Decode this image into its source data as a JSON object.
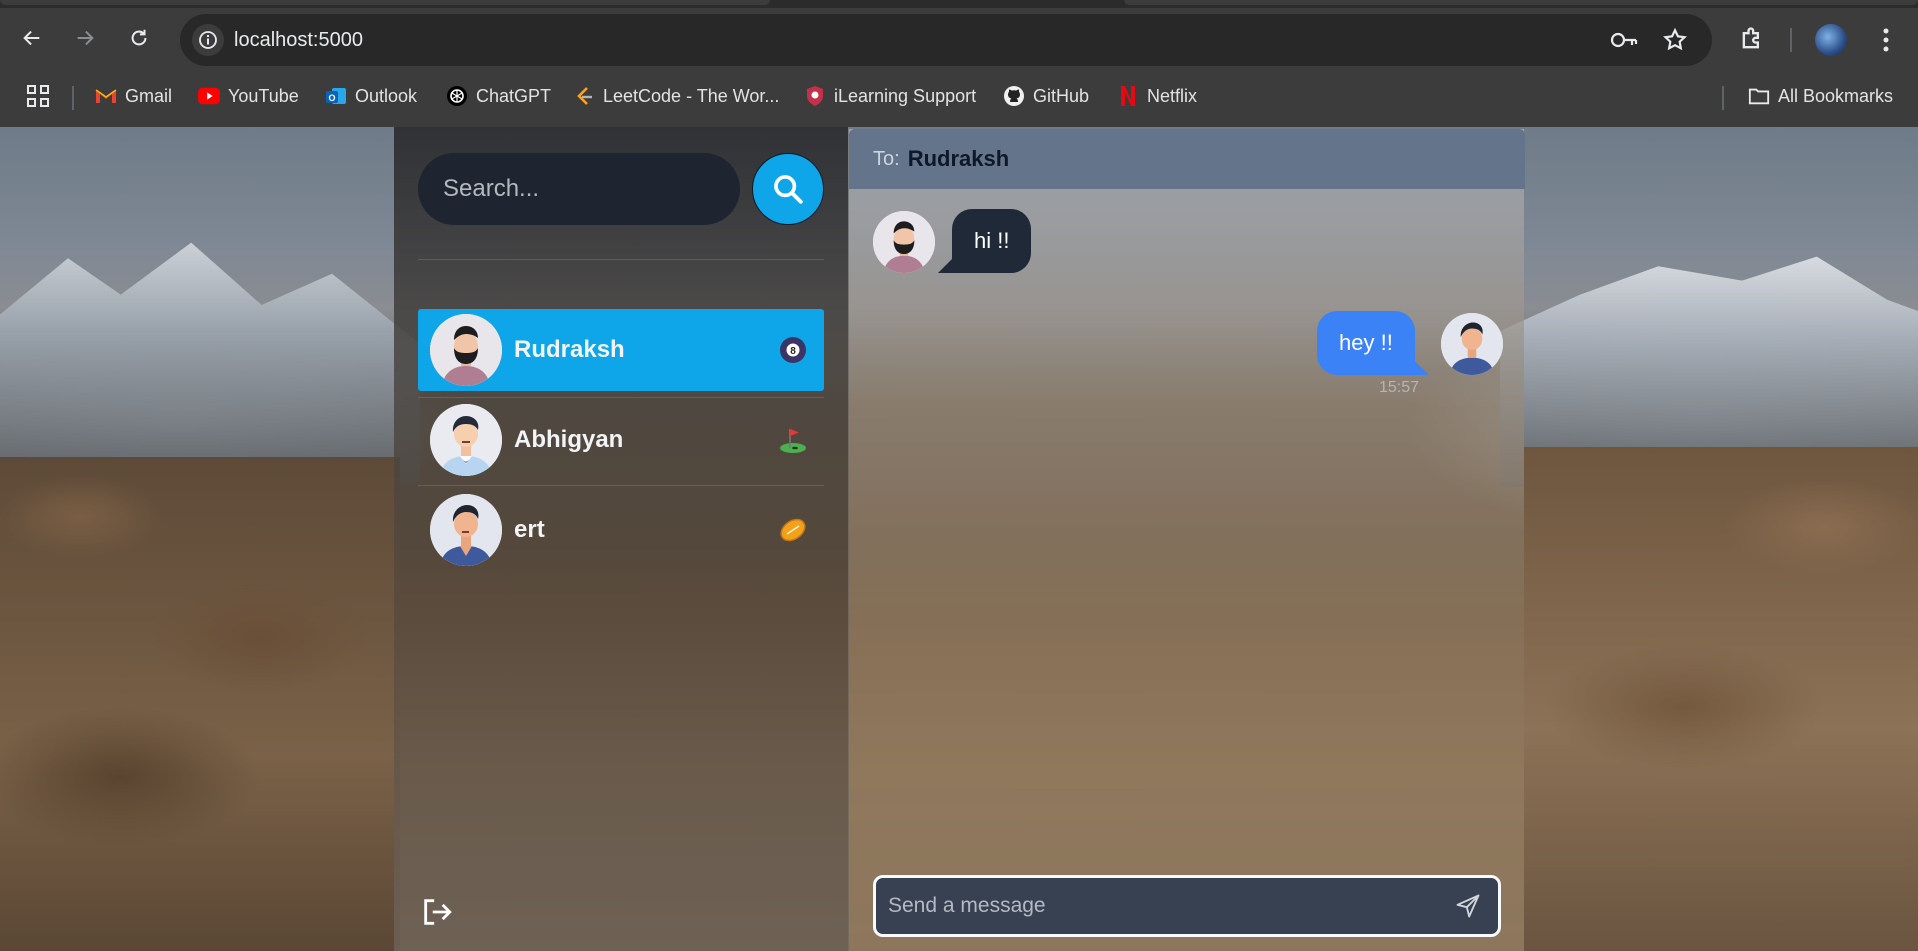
{
  "browser": {
    "url": "localhost:5000",
    "bookmarks": [
      {
        "label": "Gmail",
        "icon": "gmail-icon"
      },
      {
        "label": "YouTube",
        "icon": "youtube-icon"
      },
      {
        "label": "Outlook",
        "icon": "outlook-icon"
      },
      {
        "label": "ChatGPT",
        "icon": "chatgpt-icon"
      },
      {
        "label": "LeetCode - The Wor...",
        "icon": "leetcode-icon"
      },
      {
        "label": "iLearning Support",
        "icon": "ilearning-icon"
      },
      {
        "label": "GitHub",
        "icon": "github-icon"
      },
      {
        "label": "Netflix",
        "icon": "netflix-icon"
      }
    ],
    "all_bookmarks": "All Bookmarks"
  },
  "sidebar": {
    "search_placeholder": "Search...",
    "contacts": [
      {
        "name": "Rudraksh",
        "emoji": "8-ball",
        "active": true
      },
      {
        "name": "Abhigyan",
        "emoji": "golf-flag",
        "active": false
      },
      {
        "name": "ert",
        "emoji": "rugby-ball",
        "active": false
      }
    ]
  },
  "chat": {
    "to_label": "To:",
    "to_name": "Rudraksh",
    "messages": [
      {
        "text": "hi !!",
        "direction": "incoming"
      },
      {
        "text": "hey !!",
        "direction": "outgoing",
        "time": "15:57"
      }
    ],
    "composer_placeholder": "Send a message"
  },
  "colors": {
    "accent": "#0ea5e9",
    "outgoing_bubble": "#3b82f6",
    "incoming_bubble": "#1f2937",
    "header": "#64748b"
  }
}
